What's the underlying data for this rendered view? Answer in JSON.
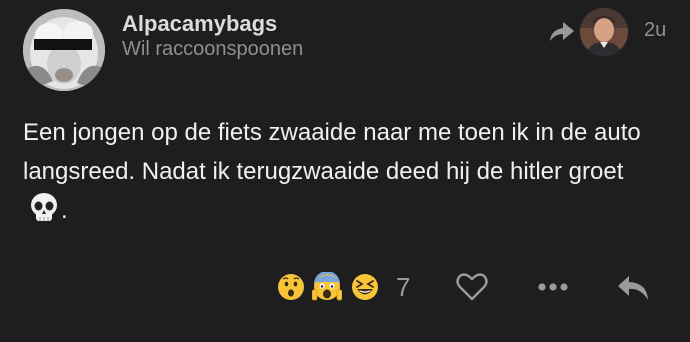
{
  "post": {
    "author": {
      "username": "Alpacamybags",
      "title": "Wil raccoonspoonen",
      "avatar_icon": "alpaca-avatar"
    },
    "reply_to": {
      "icon": "reply-arrow-icon",
      "avatar_icon": "user-avatar"
    },
    "date": "2u",
    "body": {
      "text": "Een jongen op de fiets zwaaide naar me toen ik in de auto langsreed. Nadat ik terugzwaaide deed hij de hitler groet",
      "trailing_emoji": "skull-emoji",
      "end_punctuation": "."
    }
  },
  "actions": {
    "reactions": [
      {
        "icon": "open-mouth-emoji"
      },
      {
        "icon": "scream-emoji"
      },
      {
        "icon": "laughing-emoji"
      }
    ],
    "reaction_count": "7",
    "like_icon": "heart-icon",
    "more_icon": "more-dots-icon",
    "reply_icon": "reply-icon"
  },
  "colors": {
    "background": "#1e1e1e",
    "text": "#f0f0f0",
    "muted": "#8f8f8f",
    "username": "#dcdcdc"
  }
}
